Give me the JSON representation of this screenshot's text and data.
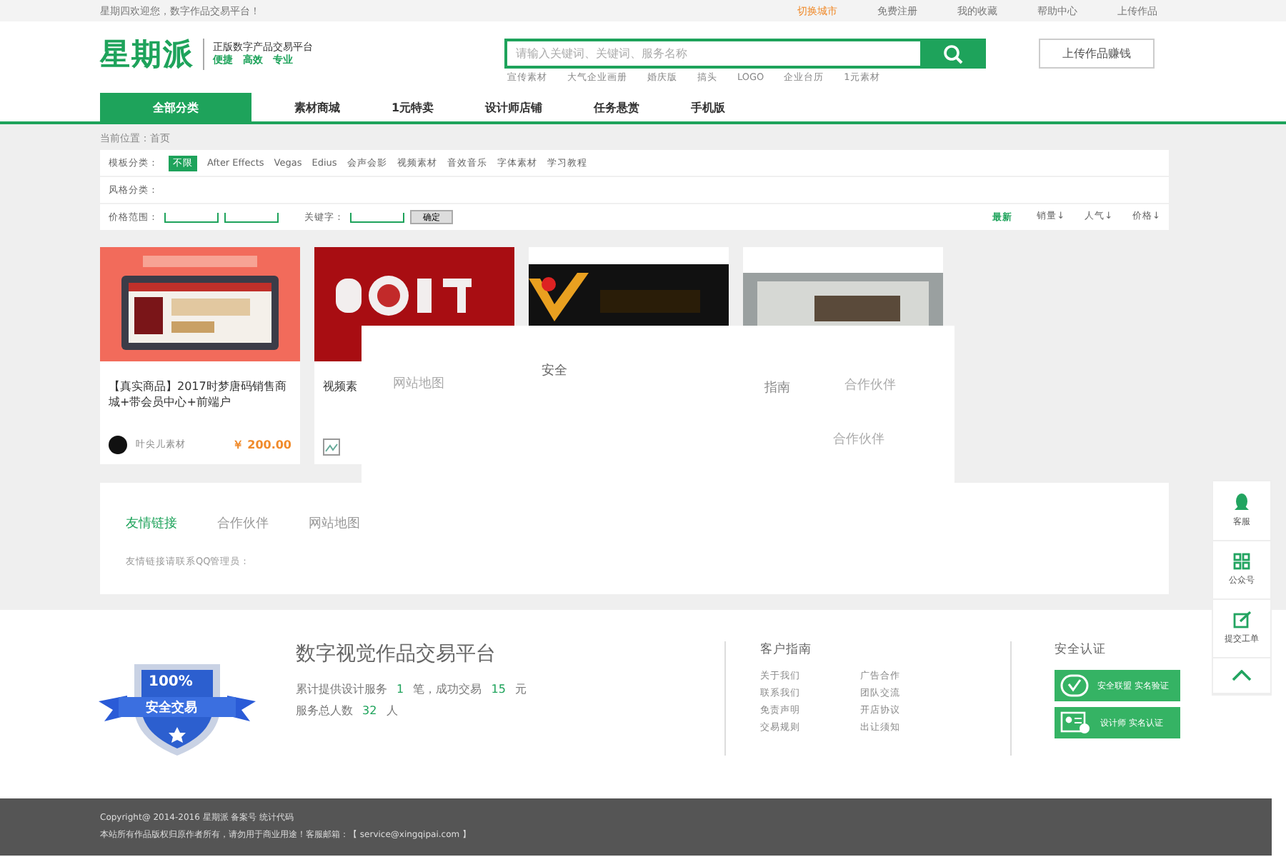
{
  "top_bar": {
    "welcome": "星期四欢迎您，数字作品交易平台！",
    "links": [
      {
        "label": "切换城市",
        "highlight": true
      },
      {
        "label": "免费注册",
        "highlight": false
      },
      {
        "label": "我的收藏",
        "highlight": false
      },
      {
        "label": "帮助中心",
        "highlight": false
      },
      {
        "label": "上传作品",
        "highlight": false
      }
    ]
  },
  "header": {
    "logo": "星期派",
    "slogan": "正版数字产品交易平台",
    "slogan_tags": "便捷　高效　专业",
    "search": {
      "placeholder": "请输入关键词、关键词、服务名称"
    },
    "hot_words": [
      "宣传素材",
      "大气企业画册",
      "婚庆版",
      "搞头",
      "LOGO",
      "企业台历",
      "1元素材"
    ],
    "upload_button": "上传作品赚钱"
  },
  "nav": {
    "all_categories": "全部分类",
    "items": [
      "素材商城",
      "1元特卖",
      "设计师店铺",
      "任务悬赏",
      "手机版"
    ]
  },
  "breadcrumb": "当前位置：首页",
  "filters": {
    "category_label": "模板分类：",
    "categories": [
      {
        "label": "不限",
        "selected": true
      },
      {
        "label": "After Effects",
        "selected": false
      },
      {
        "label": "Vegas",
        "selected": false
      },
      {
        "label": "Edius",
        "selected": false
      },
      {
        "label": "会声会影",
        "selected": false
      },
      {
        "label": "视频素材",
        "selected": false
      },
      {
        "label": "音效音乐",
        "selected": false
      },
      {
        "label": "字体素材",
        "selected": false
      },
      {
        "label": "学习教程",
        "selected": false
      }
    ],
    "style_label": "风格分类：",
    "price_label": "价格范围：",
    "keyword_label": "关键字：",
    "confirm_button": "确定",
    "sorts": [
      {
        "label": "最新",
        "selected": true
      },
      {
        "label": "销量↓",
        "selected": false
      },
      {
        "label": "人气↓",
        "selected": false
      },
      {
        "label": "价格↓",
        "selected": false
      }
    ]
  },
  "products": [
    {
      "kind": "picture",
      "title": "【真实商品】2017时梦唐码销售商城+带会员中心+前端户",
      "seller": "叶尖儿素材",
      "price": "￥ 200.00"
    },
    {
      "kind": "picture",
      "title": "视频素",
      "broken_avatar": true
    },
    {
      "kind": "picture"
    },
    {
      "kind": "picture"
    }
  ],
  "overlay_fragments": [
    "网站地图",
    "安全",
    "指南",
    "合作伙伴",
    "合作伙伴"
  ],
  "links_panel": {
    "tabs": [
      {
        "label": "友情链接",
        "selected": true
      },
      {
        "label": "合作伙伴",
        "selected": false
      },
      {
        "label": "网站地图",
        "selected": false
      }
    ],
    "note": "友情链接请联系QQ管理员："
  },
  "side_float": [
    {
      "kind": "qq",
      "label": "客服"
    },
    {
      "kind": "qr",
      "label": "公众号"
    },
    {
      "kind": "edit",
      "label": "提交工单"
    },
    {
      "kind": "top"
    }
  ],
  "footer": {
    "badge_percent": "100%",
    "badge_text": "安全交易",
    "title": "数字视觉作品交易平台",
    "stats_1": [
      "累计提供设计服务",
      "1",
      "笔，成功交易",
      "15",
      "元"
    ],
    "stats_2": [
      "服务总人数",
      "32",
      "人"
    ],
    "guide_title": "客户指南",
    "guide_links": [
      "关于我们",
      "广告合作",
      "联系我们",
      "团队交流",
      "免责声明",
      "开店协议",
      "交易规则",
      "出让须知"
    ],
    "cert_title": "安全认证",
    "certs": [
      {
        "kind": "shield",
        "text": "安全联盟 实名验证"
      },
      {
        "kind": "person",
        "text": "设计师 实名认证"
      }
    ]
  },
  "copyright": [
    "Copyright@ 2014-2016 星期派 备案号 统计代码",
    "本站所有作品版权归原作者所有，请勿用于商业用途！客服邮箱：【 service@xingqipai.com 】"
  ]
}
